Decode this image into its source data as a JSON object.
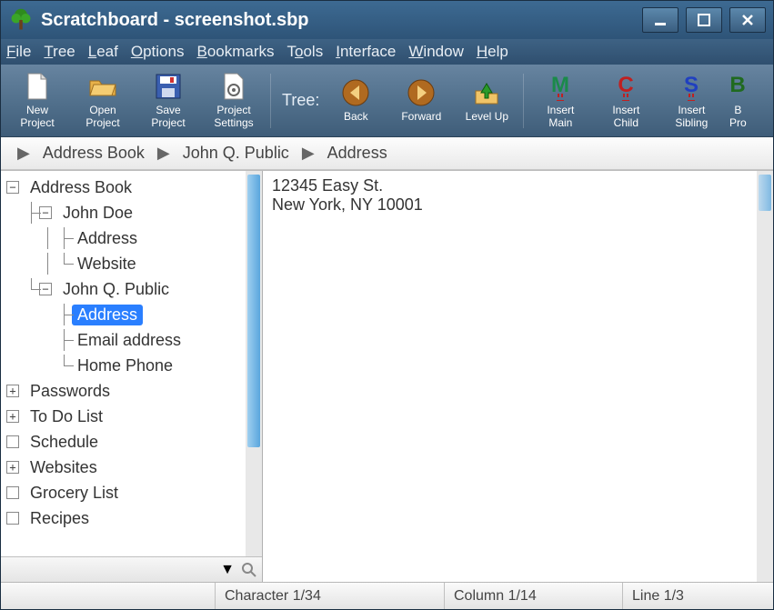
{
  "window": {
    "title": "Scratchboard - screenshot.sbp"
  },
  "menubar": [
    "File",
    "Tree",
    "Leaf",
    "Options",
    "Bookmarks",
    "Tools",
    "Interface",
    "Window",
    "Help"
  ],
  "toolbar": {
    "new_project": "New\nProject",
    "open_project": "Open\nProject",
    "save_project": "Save\nProject",
    "project_settings": "Project\nSettings",
    "tree_label": "Tree:",
    "back": "Back",
    "forward": "Forward",
    "level_up": "Level Up",
    "insert_main": "Insert\nMain",
    "insert_child": "Insert\nChild",
    "insert_sibling": "Insert\nSibling",
    "truncated": "B\nPro"
  },
  "breadcrumb": [
    "Address Book",
    "John Q. Public",
    "Address"
  ],
  "tree": {
    "root": "Address Book",
    "johndoe": "John Doe",
    "johndoe_address": "Address",
    "johndoe_website": "Website",
    "johnq": "John Q. Public",
    "johnq_address": "Address",
    "johnq_email": "Email address",
    "johnq_phone": "Home Phone",
    "passwords": "Passwords",
    "todo": "To Do List",
    "schedule": "Schedule",
    "websites": "Websites",
    "grocery": "Grocery List",
    "recipes": "Recipes"
  },
  "editor": {
    "line1": "12345 Easy St.",
    "line2": "New York, NY 10001"
  },
  "status": {
    "character": "Character 1/34",
    "column": "Column 1/14",
    "line": "Line 1/3"
  }
}
